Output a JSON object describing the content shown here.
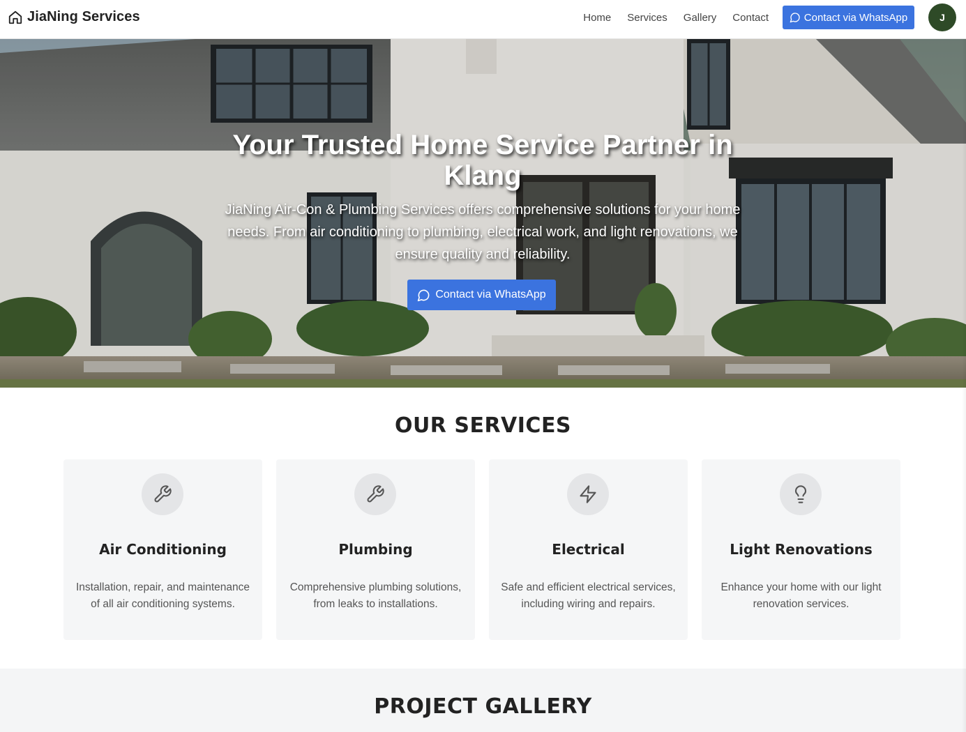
{
  "header": {
    "brand": "JiaNing Services",
    "brand_icon": "home-icon",
    "nav": [
      "Home",
      "Services",
      "Gallery",
      "Contact"
    ],
    "cta": "Contact via WhatsApp",
    "cta_icon": "message-circle-icon",
    "avatar_initial": "J"
  },
  "hero": {
    "title": "Your Trusted Home Service Partner in Klang",
    "subtitle": "JiaNing Air-Con & Plumbing Services offers comprehensive solutions for your home needs. From air conditioning to plumbing, electrical work, and light renovations, we ensure quality and reliability.",
    "cta": "Contact via WhatsApp",
    "background": "photo of white house with dark windows"
  },
  "services": {
    "title": "OUR SERVICES",
    "items": [
      {
        "title": "Air Conditioning",
        "description": "Installation, repair, and maintenance of all air conditioning systems.",
        "icon": "wrench-icon"
      },
      {
        "title": "Plumbing",
        "description": "Comprehensive plumbing solutions, from leaks to installations.",
        "icon": "wrench-icon"
      },
      {
        "title": "Electrical",
        "description": "Safe and efficient electrical services, including wiring and repairs.",
        "icon": "lightning-icon"
      },
      {
        "title": "Light Renovations",
        "description": "Enhance your home with our light renovation services.",
        "icon": "lightbulb-icon"
      }
    ]
  },
  "gallery": {
    "title": "PROJECT GALLERY"
  },
  "colors": {
    "primary": "#3b73df",
    "avatar": "#2e4a27",
    "card_bg": "#f5f6f7",
    "text_dark": "#222222"
  }
}
